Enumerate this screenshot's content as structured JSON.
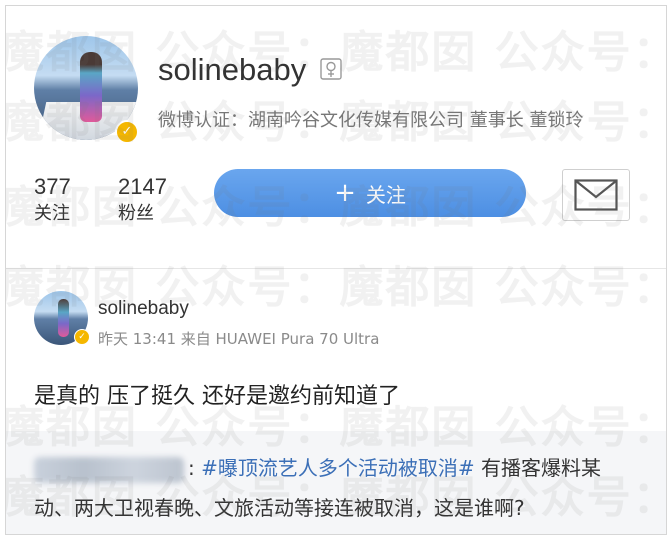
{
  "watermark": {
    "rows": [
      "魔都囡  公众号：魔都囡  公众号：魔都",
      "魔都囡  公众号：魔都囡  公众号：魔都",
      "魔都囡  公众号：魔都囡  公众号：魔都",
      "魔都囡  公众号：魔都囡  公众号：魔都",
      "魔都囡  公众号：魔都囡  公众号：魔都",
      "魔都囡  公众号：魔都囡  公众号：魔都"
    ]
  },
  "profile": {
    "username": "solinebaby",
    "gender_icon": "female-icon",
    "verification": "微博认证：湖南吟谷文化传媒有限公司 董事长 董锁玲",
    "stats": [
      {
        "value": "377",
        "label": "关注"
      },
      {
        "value": "2147",
        "label": "粉丝"
      }
    ],
    "follow_button": {
      "icon": "plus-icon",
      "label": "关注"
    },
    "message_icon": "mail-icon",
    "accent_color": "#5b9be8",
    "verified_badge_color": "#f5b700"
  },
  "post": {
    "username": "solinebaby",
    "meta": "昨天 13:41 来自 HUAWEI Pura 70 Ultra",
    "text": "是真的 压了挺久 还好是邀约前知道了",
    "repost": {
      "author_hidden": true,
      "separator": ":",
      "topic": "#曝顶流艺人多个活动被取消#",
      "line1_rest": " 有播客爆料某",
      "line2": "动、两大卫视春晚、文旅活动等接连被取消，这是谁啊?",
      "topic_color": "#3b6fb7"
    }
  }
}
